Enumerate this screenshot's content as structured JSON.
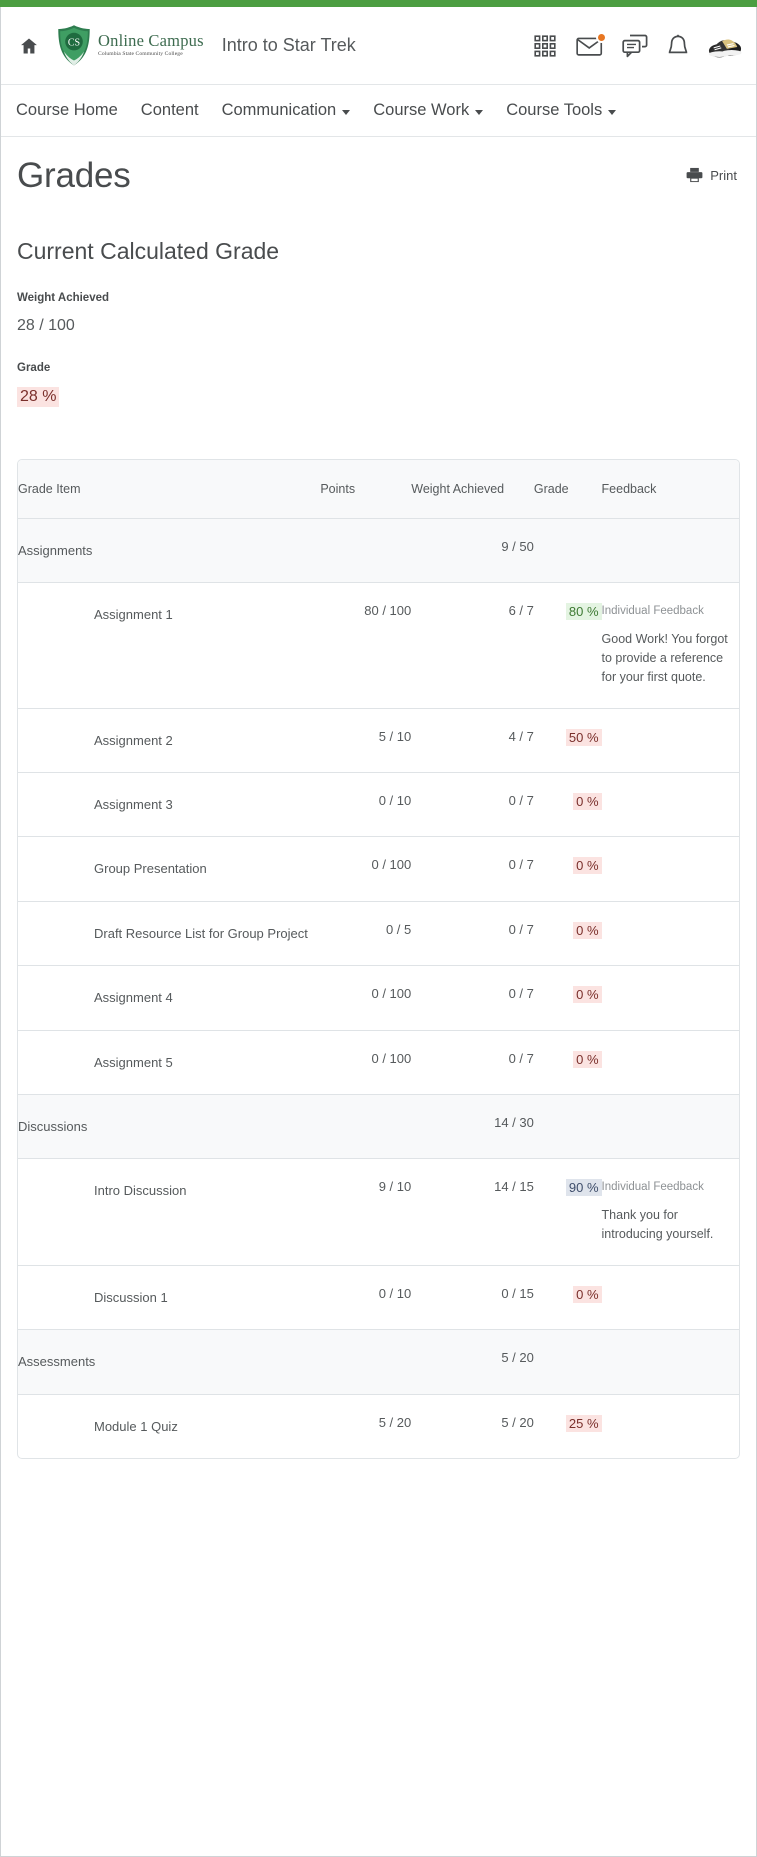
{
  "brand": {
    "accent_green": "#4c9e41",
    "logo_title": "Online Campus",
    "logo_subtitle": "Columbia State Community College",
    "logo_monogram": "CS"
  },
  "header": {
    "home_icon": "home-icon",
    "course_title": "Intro to Star Trek",
    "icons": [
      {
        "name": "waffle-grid-icon",
        "label": "Course selector"
      },
      {
        "name": "envelope-icon",
        "label": "Messages",
        "badge": true
      },
      {
        "name": "chat-bubbles-icon",
        "label": "Subscriptions"
      },
      {
        "name": "bell-icon",
        "label": "Notifications"
      },
      {
        "name": "avatar-sneakers",
        "label": "Profile"
      }
    ]
  },
  "nav": {
    "items": [
      {
        "label": "Course Home",
        "caret": false
      },
      {
        "label": "Content",
        "caret": false
      },
      {
        "label": "Communication",
        "caret": true
      },
      {
        "label": "Course Work",
        "caret": true
      },
      {
        "label": "Course Tools",
        "caret": true
      }
    ]
  },
  "page": {
    "title": "Grades",
    "print_label": "Print",
    "section_title": "Current Calculated Grade",
    "weight_label": "Weight Achieved",
    "weight_value": "28 / 100",
    "grade_label": "Grade",
    "grade_value": "28 %"
  },
  "table": {
    "columns": [
      "Grade Item",
      "Points",
      "Weight Achieved",
      "Grade",
      "Feedback"
    ],
    "rows": [
      {
        "type": "category",
        "item": "Assignments",
        "points": "",
        "weight": "9 / 50",
        "grade": "",
        "grade_style": "none",
        "feedback_label": "",
        "feedback_text": ""
      },
      {
        "type": "item",
        "item": "Assignment 1",
        "points": "80 / 100",
        "weight": "6 / 7",
        "grade": "80 %",
        "grade_style": "green",
        "feedback_label": "Individual Feedback",
        "feedback_text": "Good Work! You forgot to provide a reference for your first quote."
      },
      {
        "type": "item",
        "item": "Assignment 2",
        "points": "5 / 10",
        "weight": "4 / 7",
        "grade": "50 %",
        "grade_style": "red",
        "feedback_label": "",
        "feedback_text": ""
      },
      {
        "type": "item",
        "item": "Assignment 3",
        "points": "0 / 10",
        "weight": "0 / 7",
        "grade": "0 %",
        "grade_style": "red",
        "feedback_label": "",
        "feedback_text": ""
      },
      {
        "type": "item",
        "item": "Group Presentation",
        "points": "0 / 100",
        "weight": "0 / 7",
        "grade": "0 %",
        "grade_style": "red",
        "feedback_label": "",
        "feedback_text": ""
      },
      {
        "type": "item",
        "item": "Draft Resource List for Group Project",
        "points": "0 / 5",
        "weight": "0 / 7",
        "grade": "0 %",
        "grade_style": "red",
        "feedback_label": "",
        "feedback_text": ""
      },
      {
        "type": "item",
        "item": "Assignment 4",
        "points": "0 / 100",
        "weight": "0 / 7",
        "grade": "0 %",
        "grade_style": "red",
        "feedback_label": "",
        "feedback_text": ""
      },
      {
        "type": "item",
        "item": "Assignment 5",
        "points": "0 / 100",
        "weight": "0 / 7",
        "grade": "0 %",
        "grade_style": "red",
        "feedback_label": "",
        "feedback_text": ""
      },
      {
        "type": "category",
        "item": "Discussions",
        "points": "",
        "weight": "14 / 30",
        "grade": "",
        "grade_style": "none",
        "feedback_label": "",
        "feedback_text": ""
      },
      {
        "type": "item",
        "item": "Intro Discussion",
        "points": "9 / 10",
        "weight": "14 / 15",
        "grade": "90 %",
        "grade_style": "blue",
        "feedback_label": "Individual Feedback",
        "feedback_text": "Thank you for introducing yourself."
      },
      {
        "type": "item",
        "item": "Discussion 1",
        "points": "0 / 10",
        "weight": "0 / 15",
        "grade": "0 %",
        "grade_style": "red",
        "feedback_label": "",
        "feedback_text": ""
      },
      {
        "type": "category",
        "item": "Assessments",
        "points": "",
        "weight": "5 / 20",
        "grade": "",
        "grade_style": "none",
        "feedback_label": "",
        "feedback_text": ""
      },
      {
        "type": "item",
        "item": "Module 1 Quiz",
        "points": "5 / 20",
        "weight": "5 / 20",
        "grade": "25 %",
        "grade_style": "red",
        "feedback_label": "",
        "feedback_text": ""
      }
    ]
  },
  "colors": {
    "grade_red_bg": "#fbe3e1",
    "grade_red_fg": "#7a2f2b",
    "grade_green_bg": "#e4f4e2",
    "grade_green_fg": "#3e7a33",
    "grade_blue_bg": "#dfe4ec",
    "grade_blue_fg": "#3f4e6b",
    "badge_orange": "#e87722"
  }
}
